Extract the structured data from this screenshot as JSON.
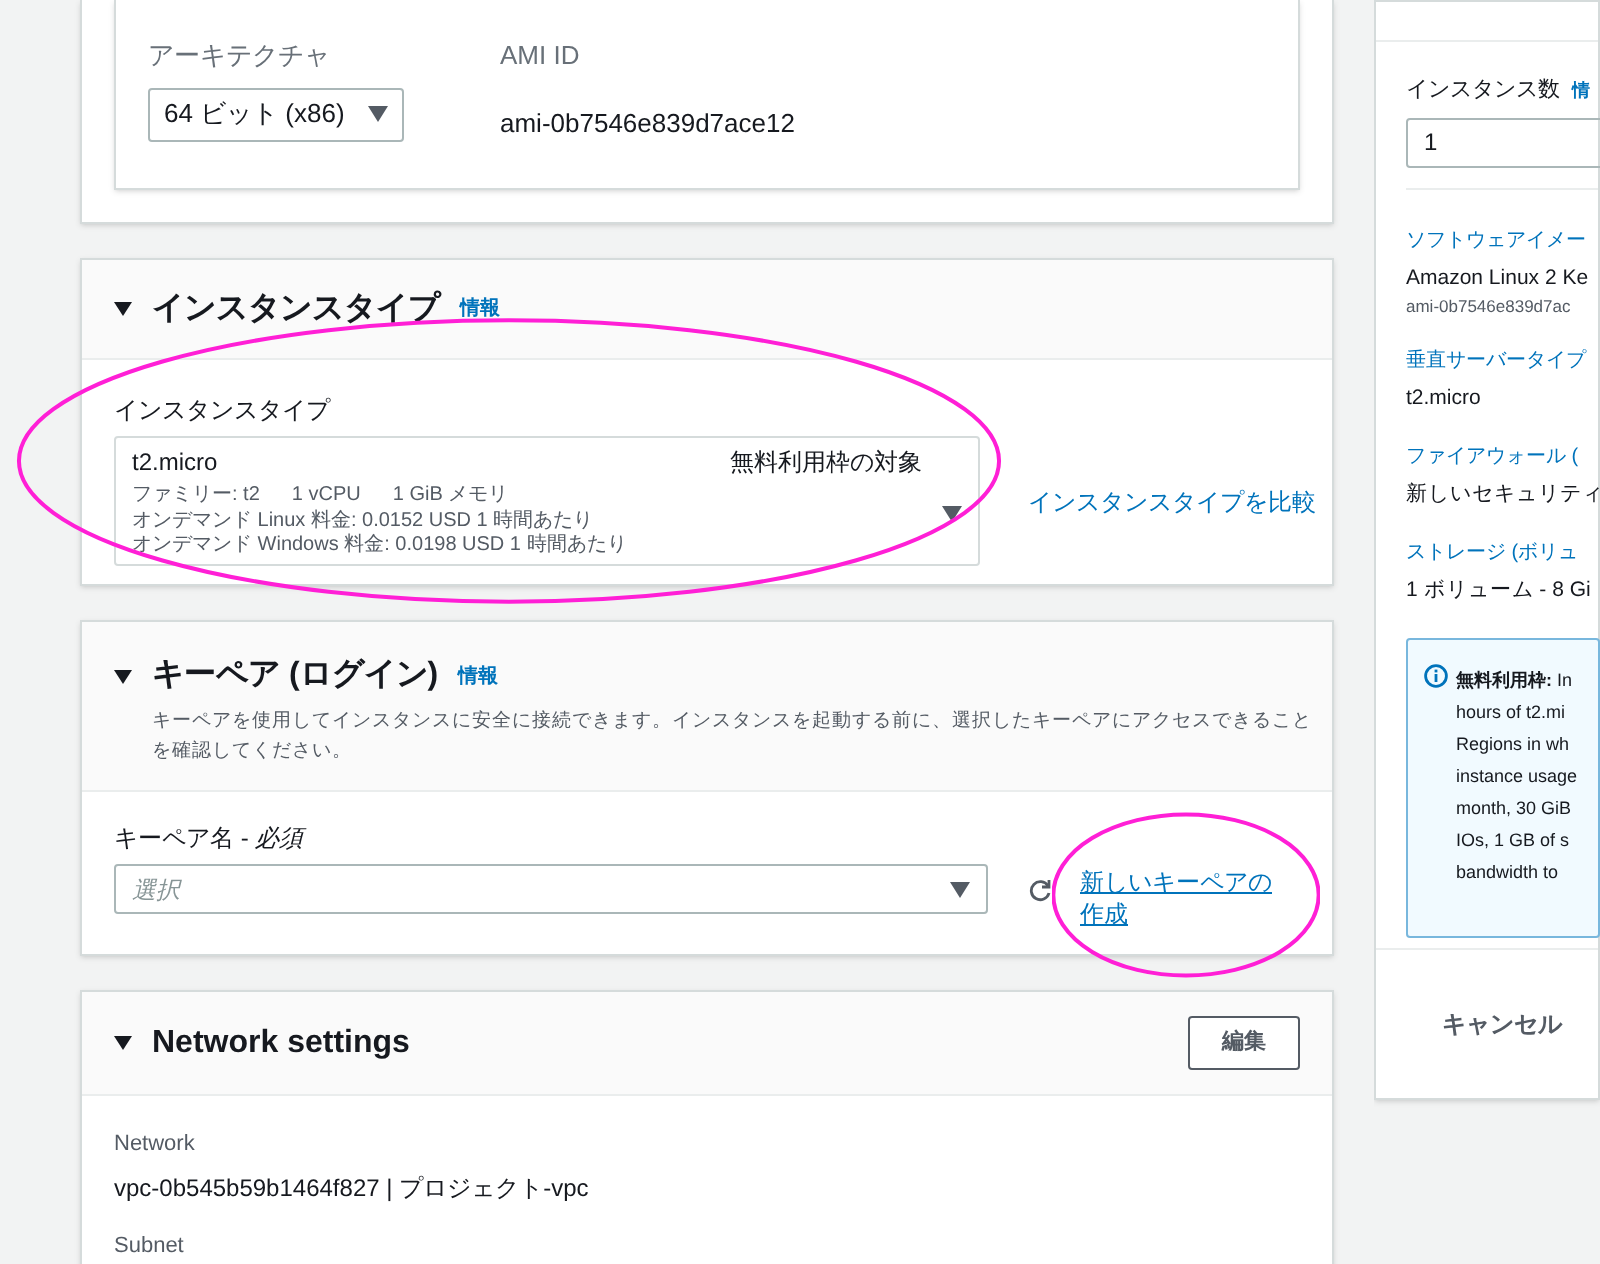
{
  "ami_details": {
    "architecture": {
      "label": "アーキテクチャ",
      "value": "64 ビット (x86)"
    },
    "ami_id": {
      "label": "AMI ID",
      "value": "ami-0b7546e839d7ace12"
    }
  },
  "instance_type": {
    "title": "インスタンスタイプ",
    "info": "情報",
    "field_label": "インスタンスタイプ",
    "select": {
      "name": "t2.micro",
      "badge": "無料利用枠の対象",
      "details": [
        "ファミリー: t2",
        "1 vCPU",
        "1 GiB メモリ"
      ],
      "pricing": [
        "オンデマンド Linux 料金: 0.0152 USD 1 時間あたり",
        "オンデマンド Windows 料金: 0.0198 USD 1 時間あたり"
      ],
      "circled": true
    },
    "compare_link": "インスタンスタイプを比較"
  },
  "key_pair": {
    "title": "キーペア (ログイン)",
    "info": "情報",
    "description": "キーペアを使用してインスタンスに安全に接続できます。インスタンスを起動する前に、選択したキーペアにアクセスできることを確認してください。",
    "field_label": "キーペア名 - *必須*",
    "placeholder": "選択",
    "create_link": {
      "label": "新しいキーペアの作成",
      "circled": true
    }
  },
  "network_settings": {
    "title": "Network settings",
    "edit_button": "編集",
    "fields": [
      {
        "label": "Network",
        "value": "vpc-0b545b59b1464f827 | プロジェクト-vpc"
      },
      {
        "label": "Subnet"
      }
    ]
  },
  "summary": {
    "instance_count": {
      "label": "インスタンス数",
      "info": "情",
      "value": "1"
    },
    "items": [
      {
        "title": "ソフトウェアイメー",
        "value": "Amazon Linux 2 Ke",
        "sub": "ami-0b7546e839d7ac"
      },
      {
        "title": "垂直サーバータイプ",
        "value": "t2.micro"
      },
      {
        "title": "ファイアウォール (",
        "value": "新しいセキュリティ"
      },
      {
        "title": "ストレージ (ボリュ",
        "value": "1 ボリューム - 8 Gi"
      }
    ],
    "free_tier": [
      "**無料利用枠:** In",
      "hours of t2.mi",
      "Regions in wh",
      "instance usage",
      "month, 30 GiB",
      "IOs, 1 GB of s",
      "bandwidth to"
    ],
    "cancel_button": "キャンセル"
  }
}
